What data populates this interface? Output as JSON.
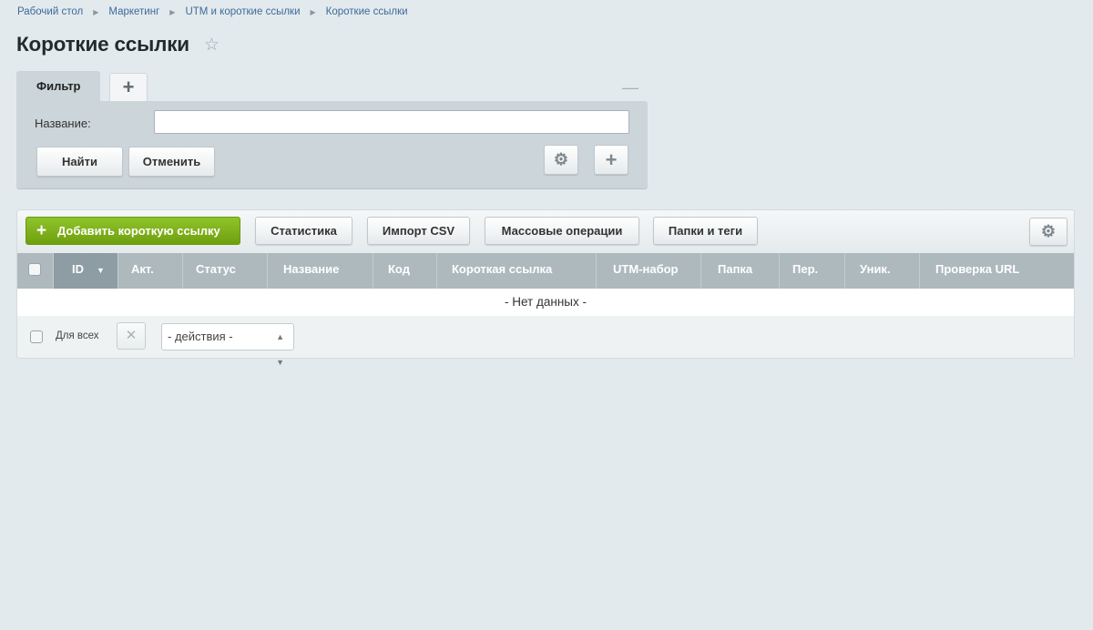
{
  "breadcrumb": [
    "Рабочий стол",
    "Маркетинг",
    "UTM и короткие ссылки",
    "Короткие ссылки"
  ],
  "page_title": "Короткие ссылки",
  "filter": {
    "tab_label": "Фильтр",
    "name_label": "Название:",
    "name_value": "",
    "find_button": "Найти",
    "cancel_button": "Отменить"
  },
  "toolbar": {
    "add_button": "Добавить короткую ссылку",
    "stats_button": "Статистика",
    "import_button": "Импорт CSV",
    "mass_button": "Массовые операции",
    "folders_button": "Папки и теги"
  },
  "table": {
    "columns": [
      "ID",
      "Акт.",
      "Статус",
      "Название",
      "Код",
      "Короткая ссылка",
      "UTM-набор",
      "Папка",
      "Пер.",
      "Уник.",
      "Проверка URL"
    ],
    "empty_text": "- Нет данных -"
  },
  "footer": {
    "for_all_label": "Для всех",
    "actions_select": "- действия -"
  }
}
